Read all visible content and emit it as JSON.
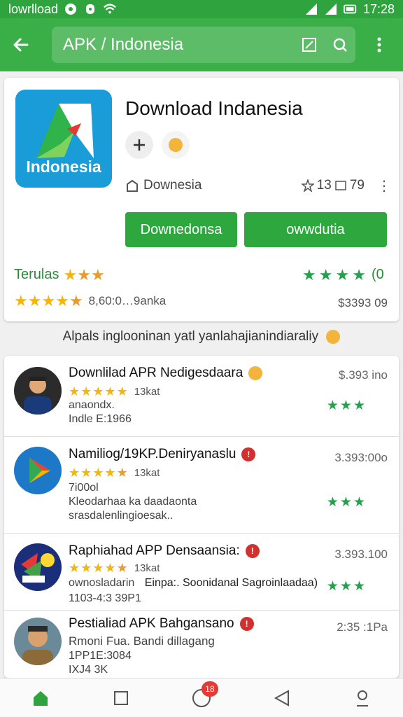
{
  "status_bar": {
    "left_label": "lowrlload",
    "time": "17:28",
    "icons": [
      "notification-icon",
      "lock-icon",
      "wifi-icon",
      "signal-icon",
      "battery-icon"
    ]
  },
  "app_bar": {
    "search_query": "APK / Indonesia",
    "icons": [
      "back-arrow-icon",
      "bookmark-icon",
      "search-icon",
      "more-vert-icon"
    ]
  },
  "app_detail": {
    "logo_text": "Indonesia",
    "title": "Download Indanesia",
    "developer": "Downesia",
    "stat_a": "13",
    "stat_b": "79",
    "install_label": "Downedonsa",
    "open_label": "owwdutia",
    "rating_label": "Terulas",
    "rating_count_right": "(0",
    "downloads_text": "8,60:0…9anka",
    "size_text": "$3393 09",
    "colors": {
      "primary": "#3aae47",
      "star": "#f5b50a",
      "logo_bg": "#1a9cd8"
    }
  },
  "caption": "Alpals inglooninan yatl yanlahajianindiaraliy",
  "list": {
    "items": [
      {
        "title": "Downlilad APR Nedigesdaara",
        "price": "$.393 ino",
        "rating_count": "13kat",
        "line1": "anaondx.",
        "line2": "Indle E:1966"
      },
      {
        "title": "Namiliog/19KP.Deniryanaslu",
        "price": "3.393:00o",
        "rating_count": "13kat",
        "line1": "7i00ol",
        "line2": "Kleodarhaa ka daadaonta",
        "line3": "srasdalenlingioesak.."
      },
      {
        "title": "Raphiahad APP Densaansia:",
        "price": "3.393.100",
        "rating_count": "13kat",
        "line1": "ownosladarin",
        "line1b": "Einpa:. Soonidanal Sagroinlaadaa)",
        "line2": "1103-4:3 39P1"
      },
      {
        "title": "Pestialiad APK Bahgansano",
        "price": "2:35 :1Pa",
        "line1": "Rmoni Fua. Bandi dillagang",
        "line2": "1PP1E:3084",
        "line3": "IXJ4 3K"
      }
    ]
  },
  "nav": {
    "badge": "18",
    "icons": [
      "home-icon",
      "square-icon",
      "circle-icon",
      "triangle-back-icon",
      "person-icon"
    ]
  }
}
